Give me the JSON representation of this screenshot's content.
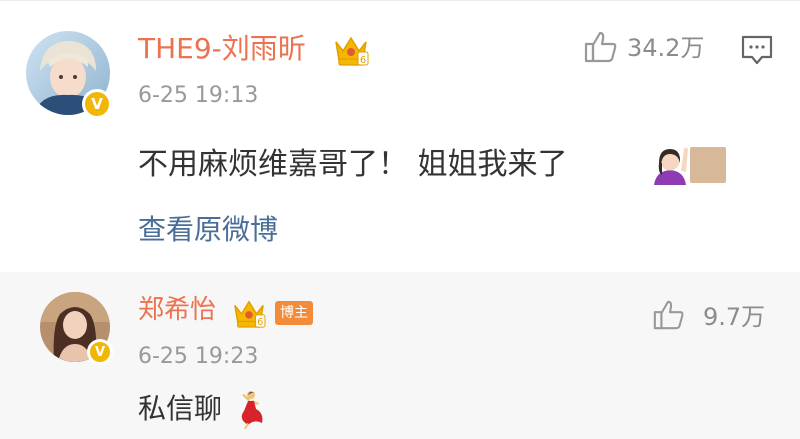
{
  "comment": {
    "username": "THE9-刘雨昕",
    "time": "6-25 19:13",
    "text": "不用麻烦维嘉哥了！ 姐姐我来了",
    "view_original": "查看原微博",
    "likes": "34.2万"
  },
  "reply": {
    "username": "郑希怡",
    "badge_tag": "博主",
    "time": "6-25 19:23",
    "text": "私信聊",
    "likes": "9.7万"
  },
  "icons": {
    "like": "thumbs-up-icon",
    "comment": "comment-bubble-icon",
    "crown": "crown-icon",
    "verified": "verified-v-icon",
    "raise_hand": "woman-raising-hand-emoji",
    "dancer": "dancer-emoji"
  },
  "verified_badge_letter": "V",
  "colors": {
    "username": "#eb7350",
    "link": "#4a6e97",
    "time": "#999999",
    "text": "#333333",
    "reply_bg": "#f7f7f7",
    "crown": "#f5b800",
    "blogger_tag": "#f28c3b"
  }
}
